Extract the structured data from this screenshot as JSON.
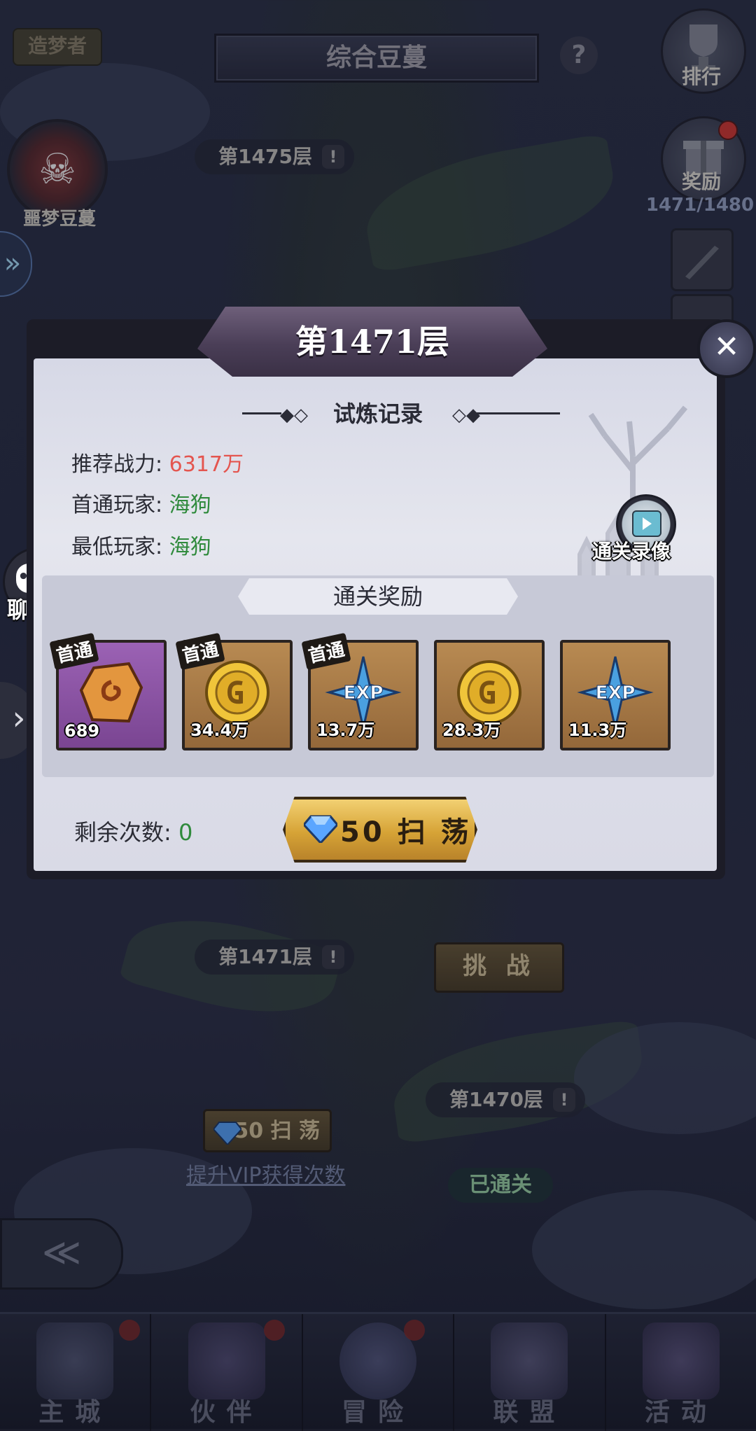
{
  "top_bar": {
    "title": "综合豆蔓",
    "help_icon": "?",
    "dream_tag": "造梦者",
    "rank_label": "排行",
    "reward_label": "奖励",
    "reward_progress": "1471/1480",
    "nightmare_label": "噩梦豆蔓"
  },
  "background": {
    "floor_1475": "第1475层",
    "floor_1471": "第1471层",
    "floor_1470": "第1470层",
    "challenge_label": "挑 战",
    "sweep_small_label": "50 扫 荡",
    "vip_link": "提升VIP获得次数",
    "passed_label": "已通关",
    "excl": "!"
  },
  "dialog": {
    "title": "第1471层",
    "section_title": "试炼记录",
    "rows": [
      {
        "label": "推荐战力:",
        "value": "6317万",
        "color": "#e4554f"
      },
      {
        "label": "首通玩家:",
        "value": "海狗",
        "color": "#2f8a3c"
      },
      {
        "label": "最低玩家:",
        "value": "海狗",
        "color": "#2f8a3c"
      }
    ],
    "replay_label": "通关录像",
    "reward_header": "通关奖励",
    "rewards": [
      {
        "icon": "rune-stone-icon",
        "count": "689",
        "first": "首通",
        "rarity": "purple"
      },
      {
        "icon": "gold-coin-icon",
        "count": "34.4万",
        "first": "首通",
        "rarity": "gold"
      },
      {
        "icon": "exp-star-icon",
        "count": "13.7万",
        "first": "首通",
        "rarity": "gold"
      },
      {
        "icon": "gold-coin-icon",
        "count": "28.3万",
        "first": "",
        "rarity": "gold"
      },
      {
        "icon": "exp-star-icon",
        "count": "11.3万",
        "first": "",
        "rarity": "gold"
      }
    ],
    "remaining_label": "剩余次数:",
    "remaining_value": "0",
    "sweep_label": "50 扫 荡"
  },
  "chat": {
    "label": "聊天",
    "dots": "•••"
  },
  "nav": [
    {
      "label": "主城",
      "badge": true
    },
    {
      "label": "伙伴",
      "badge": true
    },
    {
      "label": "冒险",
      "badge": true
    },
    {
      "label": "联盟",
      "badge": false
    },
    {
      "label": "活动",
      "badge": false
    }
  ],
  "colors": {
    "accent_gold": "#d6a336",
    "value_red": "#e4554f",
    "value_green": "#2f8a3c",
    "badge_red": "#d83a34"
  }
}
